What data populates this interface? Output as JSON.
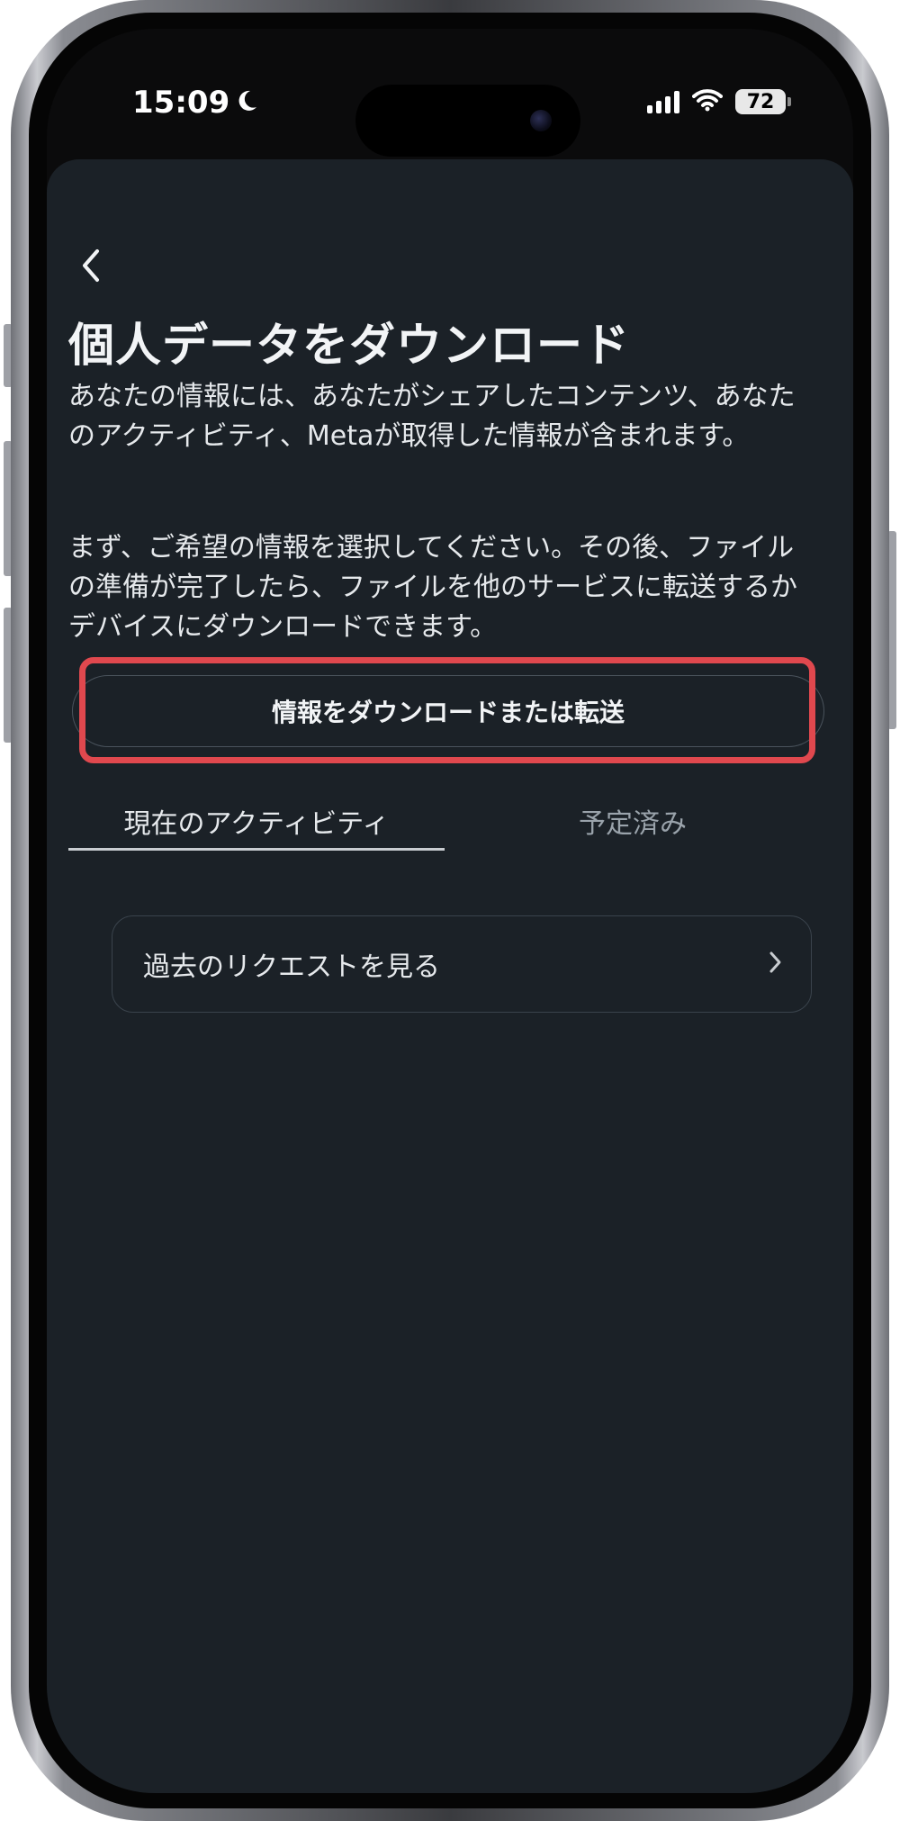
{
  "status_bar": {
    "time": "15:09",
    "battery_level": "72",
    "icons": [
      "moon-icon",
      "signal-bars-icon",
      "wifi-icon",
      "battery-icon"
    ]
  },
  "header": {
    "back_icon": "chevron-left-icon",
    "title": "個人データをダウンロード"
  },
  "description": {
    "paragraph_1": "あなたの情報には、あなたがシェアしたコンテンツ、あなたのアクティビティ、Metaが取得した情報が含まれます。",
    "paragraph_2": "まず、ご希望の情報を選択してください。その後、ファイルの準備が完了したら、ファイルを他のサービスに転送するかデバイスにダウンロードできます。"
  },
  "primary_action": {
    "label": "情報をダウンロードまたは転送"
  },
  "tabs": [
    {
      "label": "現在のアクティビティ",
      "selected": true
    },
    {
      "label": "予定済み",
      "selected": false
    }
  ],
  "list": {
    "items": [
      {
        "label": "過去のリクエストを見る",
        "icon": "chevron-right-icon"
      }
    ]
  },
  "colors": {
    "sheet_background": "#1b2127",
    "highlight": "#e0484e",
    "text_primary": "#f2f4f6",
    "text_secondary": "#9aa3ab"
  }
}
